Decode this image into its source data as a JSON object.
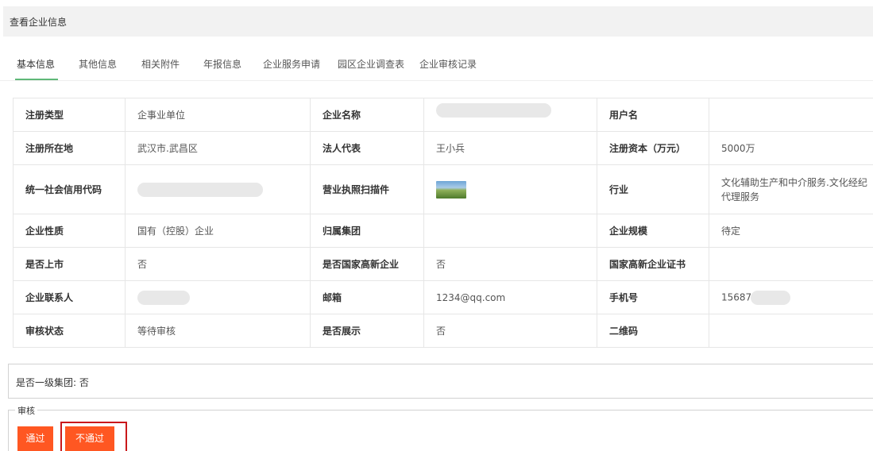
{
  "header": {
    "title": "查看企业信息"
  },
  "tabs": [
    {
      "label": "基本信息",
      "active": true
    },
    {
      "label": "其他信息"
    },
    {
      "label": "相关附件"
    },
    {
      "label": "年报信息"
    },
    {
      "label": "企业服务申请"
    },
    {
      "label": "园区企业调查表"
    },
    {
      "label": "企业审核记录"
    }
  ],
  "info": {
    "reg_type_label": "注册类型",
    "reg_type": "企事业单位",
    "company_name_label": "企业名称",
    "username_label": "用户名",
    "location_label": "注册所在地",
    "location": "武汉市.武昌区",
    "legal_rep_label": "法人代表",
    "legal_rep": "王小兵",
    "capital_label": "注册资本（万元）",
    "capital": "5000万",
    "credit_code_label": "统一社会信用代码",
    "license_label": "营业执照扫描件",
    "industry_label": "行业",
    "industry": "文化辅助生产和中介服务.文化经纪代理服务",
    "nature_label": "企业性质",
    "nature": "国有（控股）企业",
    "group_label": "归属集团",
    "scale_label": "企业规模",
    "scale": "待定",
    "listed_label": "是否上市",
    "listed": "否",
    "hightech_label": "是否国家高新企业",
    "hightech": "否",
    "hightech_cert_label": "国家高新企业证书",
    "contact_label": "企业联系人",
    "email_label": "邮箱",
    "email": "1234@qq.com",
    "phone_label": "手机号",
    "phone_prefix": "15687(",
    "status_label": "审核状态",
    "status": "等待审核",
    "display_label": "是否展示",
    "display": "否",
    "qr_label": "二维码"
  },
  "group_level": {
    "text": "是否一级集团: 否"
  },
  "audit": {
    "legend": "审核",
    "pass_label": "通过",
    "fail_label": "不通过"
  },
  "colors": {
    "accent": "#5fb878",
    "button": "#ff5722",
    "highlight": "#c9181b"
  }
}
